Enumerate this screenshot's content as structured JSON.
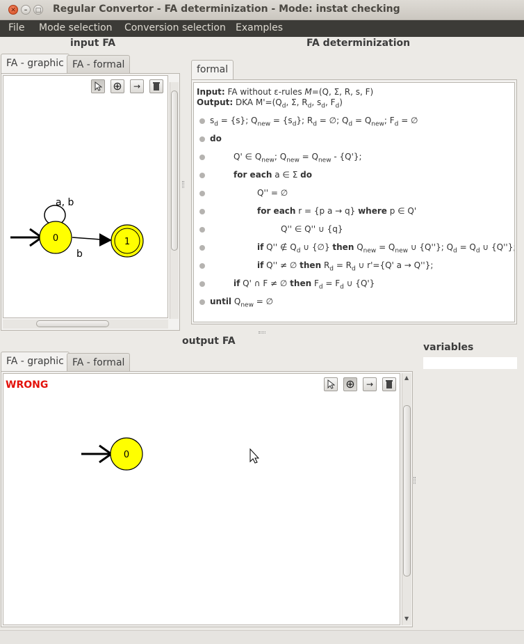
{
  "window": {
    "title": "Regular Convertor - FA determinization - Mode: instat checking",
    "close_glyph": "✕",
    "min_glyph": "–",
    "max_glyph": "□"
  },
  "menu": [
    "File",
    "Mode selection",
    "Conversion selection",
    "Examples"
  ],
  "input_fa": {
    "label": "input FA",
    "tabs": [
      "FA - graphic",
      "FA - formal"
    ],
    "states": [
      "0",
      "1"
    ],
    "edge_labels": {
      "self_loop": "a, b",
      "transition": "b"
    }
  },
  "determinization": {
    "label": "FA determinization",
    "tab": "formal",
    "input_label": "Input:",
    "input_text": "FA without ε-rules M=(Q, Σ, R, s, F)",
    "output_label": "Output:",
    "output_text": "DKA M'=(Q",
    "algorithm_lines": [
      "s_d = {s}; Q_new = {s_d}; R_d = ∅; Q_d = Q_new; F_d = ∅",
      "do",
      "Q' ∈ Q_new; Q_new = Q_new - {Q'};",
      "for each a ∈ Σ do",
      "Q'' = ∅",
      "for each r = {p a → q} where p ∈ Q'",
      "Q'' ∈ Q'' ∪ {q}",
      "if Q'' ∉ Q_d ∪ {∅} then Q_new = Q_new ∪ {Q''}; Q_d = Q_d ∪ {Q''};",
      "if Q'' ≠ ∅ then R_d = R_d ∪ r'={Q' a → Q''};",
      "if Q' ∩ F ≠ ∅ then F_d = F_d ∪ {Q'}",
      "until Q_new = ∅"
    ]
  },
  "output_fa": {
    "label": "output FA",
    "tabs": [
      "FA - graphic",
      "FA - formal"
    ],
    "status": "WRONG",
    "states": [
      "0"
    ]
  },
  "variables": {
    "label": "variables",
    "value": ""
  },
  "tools": {
    "select": "select-tool",
    "add_state": "add-state-tool",
    "add_transition": "add-transition-tool",
    "delete": "delete-tool",
    "add_state_glyph": "⊕",
    "arrow_glyph": "→"
  },
  "colors": {
    "state_fill": "#ffff00",
    "wrong": "#e3120b",
    "menubar": "#3c3b37"
  }
}
